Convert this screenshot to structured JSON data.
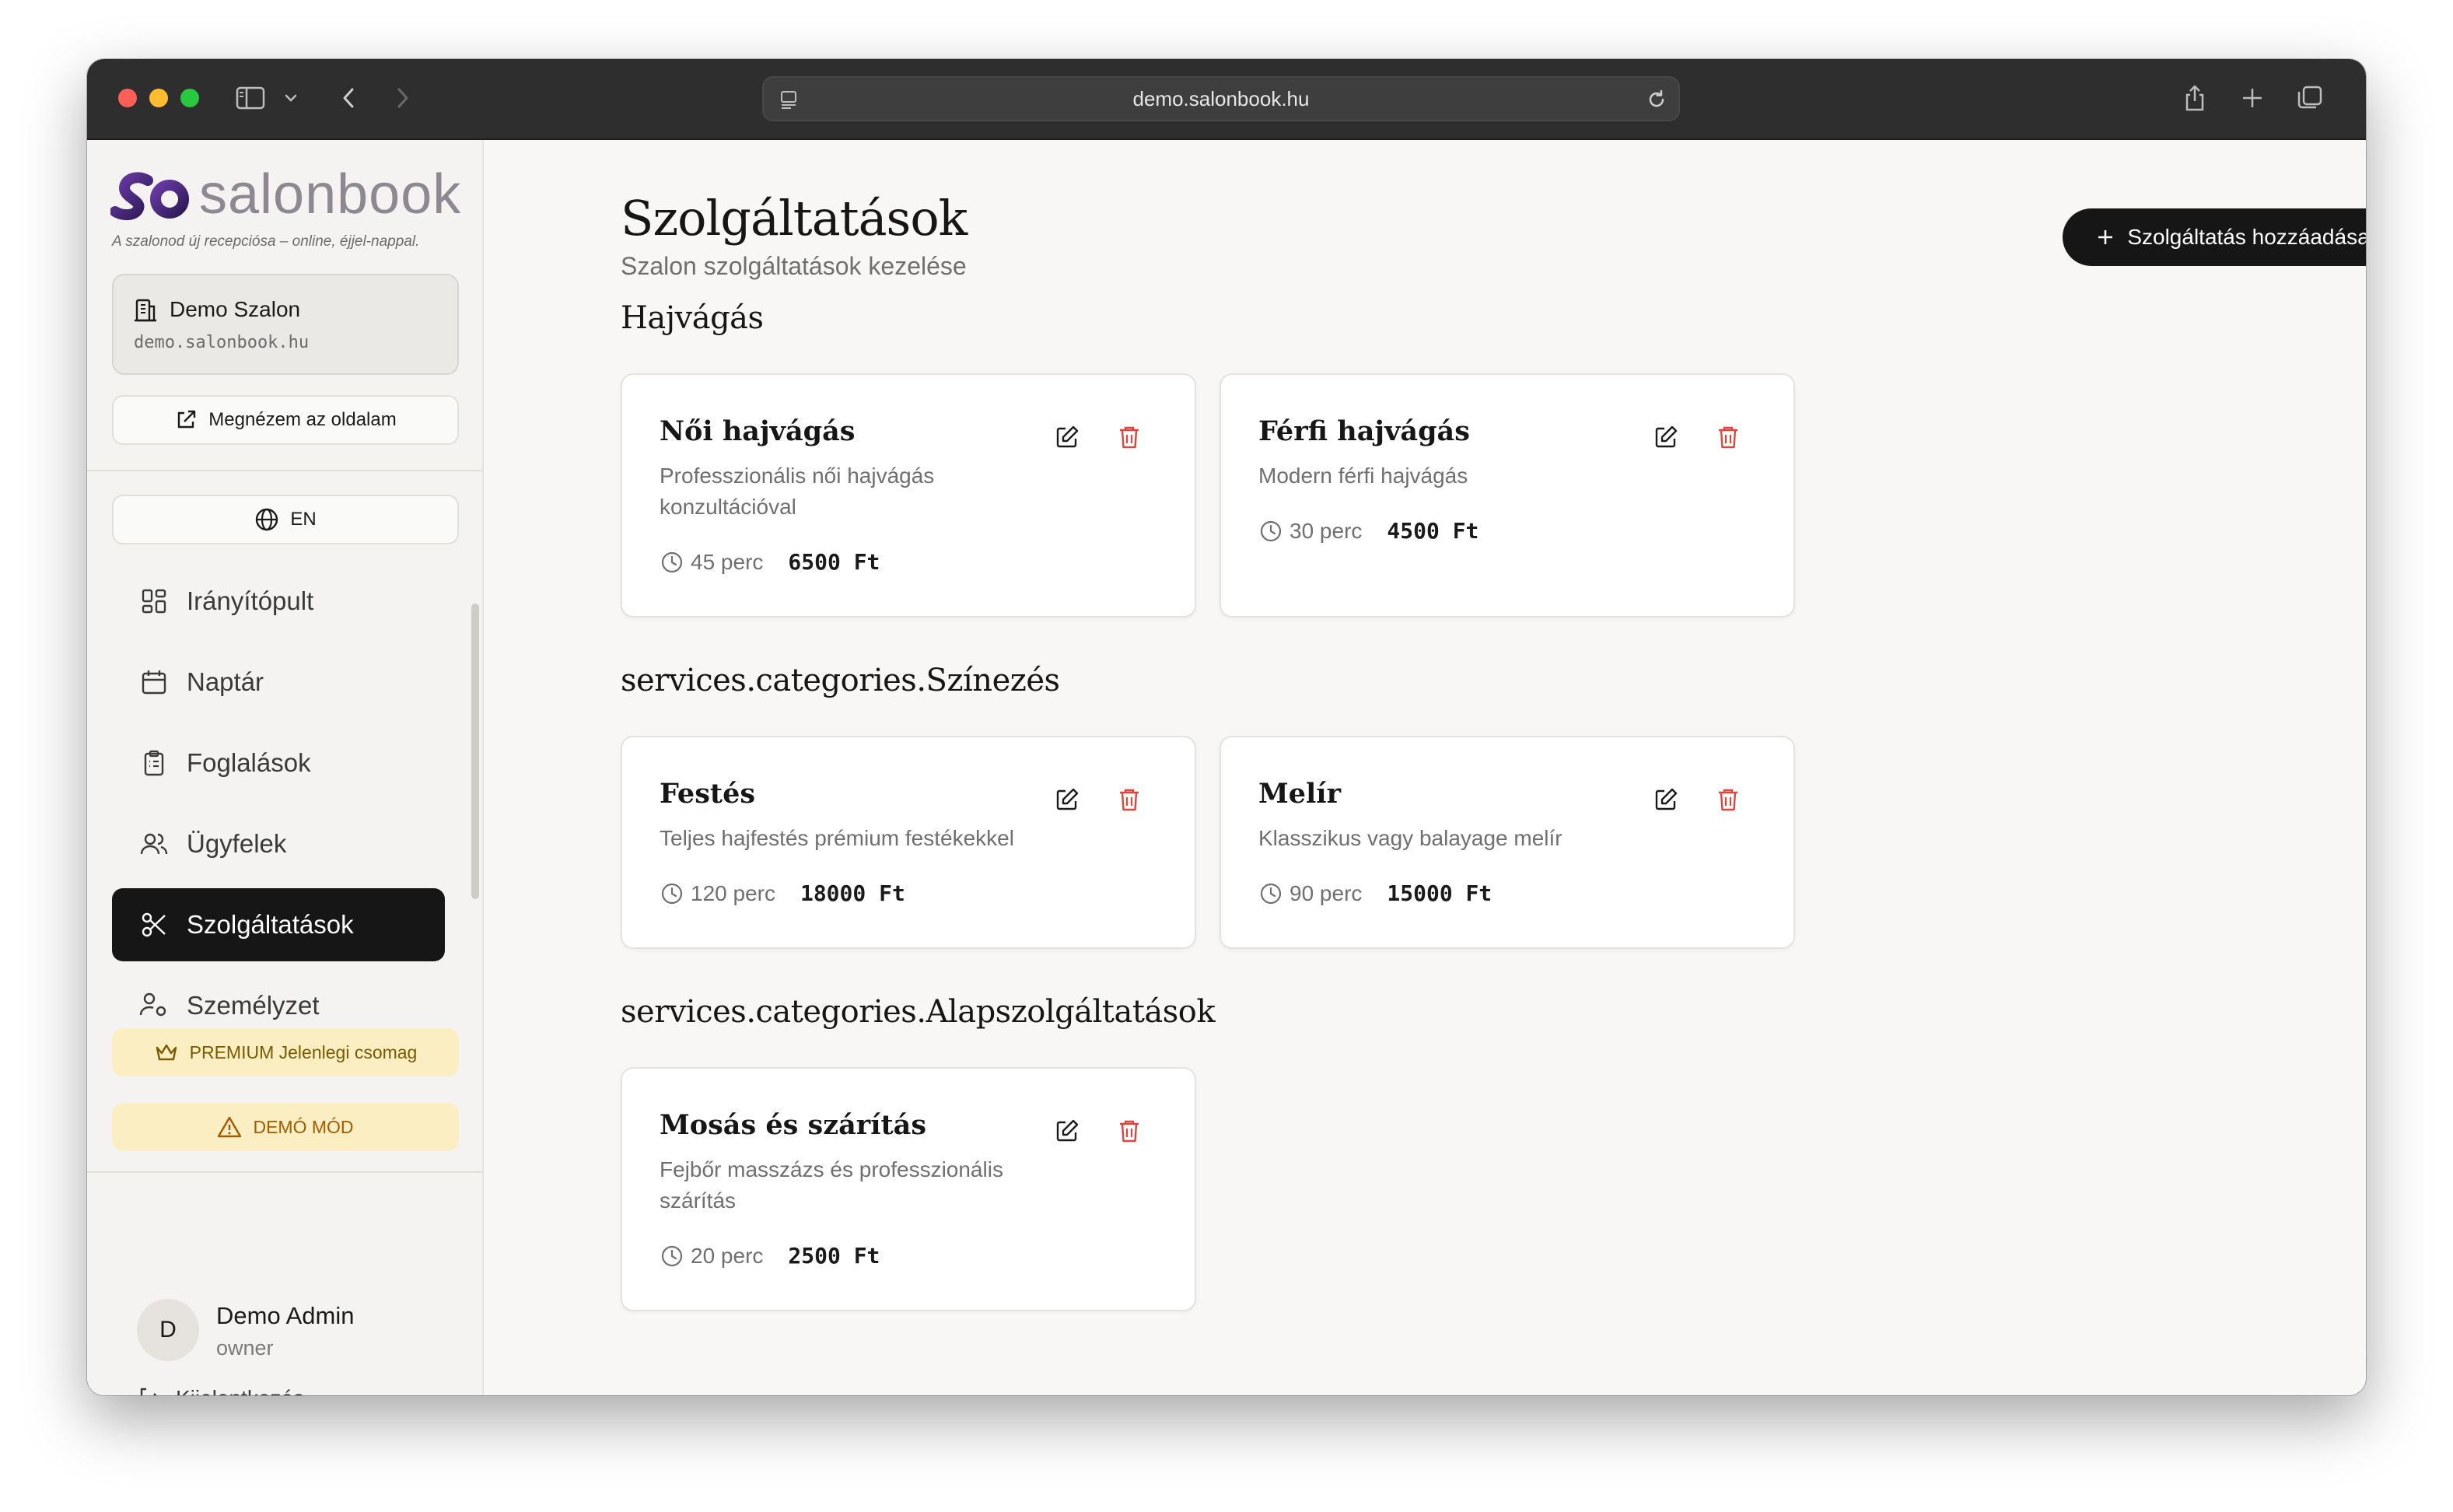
{
  "browser": {
    "url": "demo.salonbook.hu"
  },
  "sidebar": {
    "logo_text": "salonbook",
    "tagline": "A szalonod új recepciósa – online, éjjel-nappal.",
    "salon_name": "Demo Szalon",
    "salon_domain": "demo.salonbook.hu",
    "view_site_label": "Megnézem az oldalam",
    "language_label": "EN",
    "nav": [
      {
        "label": "Irányítópult",
        "icon": "dashboard-icon",
        "active": false
      },
      {
        "label": "Naptár",
        "icon": "calendar-icon",
        "active": false
      },
      {
        "label": "Foglalások",
        "icon": "clipboard-icon",
        "active": false
      },
      {
        "label": "Ügyfelek",
        "icon": "users-icon",
        "active": false
      },
      {
        "label": "Szolgáltatások",
        "icon": "scissors-icon",
        "active": true
      },
      {
        "label": "Személyzet",
        "icon": "user-cog-icon",
        "active": false
      }
    ],
    "plan_badge": "PREMIUM Jelenlegi csomag",
    "demo_badge": "DEMÓ MÓD",
    "user": {
      "initial": "D",
      "name": "Demo Admin",
      "role": "owner"
    },
    "logout_label": "Kijelentkezés"
  },
  "header": {
    "title": "Szolgáltatások",
    "subtitle": "Szalon szolgáltatások kezelése",
    "add_button_label": "Szolgáltatás hozzáadása"
  },
  "categories": [
    {
      "title": "Hajvágás",
      "services": [
        {
          "name": "Női hajvágás",
          "description": "Professzionális női hajvágás konzultációval",
          "duration": "45 perc",
          "price": "6500 Ft"
        },
        {
          "name": "Férfi hajvágás",
          "description": "Modern férfi hajvágás",
          "duration": "30 perc",
          "price": "4500 Ft"
        }
      ]
    },
    {
      "title": "services.categories.Színezés",
      "services": [
        {
          "name": "Festés",
          "description": "Teljes hajfestés prémium festékekkel",
          "duration": "120 perc",
          "price": "18000 Ft"
        },
        {
          "name": "Melír",
          "description": "Klasszikus vagy balayage melír",
          "duration": "90 perc",
          "price": "15000 Ft"
        }
      ]
    },
    {
      "title": "services.categories.Alapszolgáltatások",
      "services": [
        {
          "name": "Mosás és szárítás",
          "description": "Fejbőr masszázs és professzionális szárítás",
          "duration": "20 perc",
          "price": "2500 Ft"
        }
      ]
    }
  ],
  "colors": {
    "accent_dark": "#161616",
    "delete_red": "#d9473f",
    "premium_bg": "#fbeec2",
    "premium_text": "#7a5a00",
    "logo_purple": "#4b2a78"
  }
}
